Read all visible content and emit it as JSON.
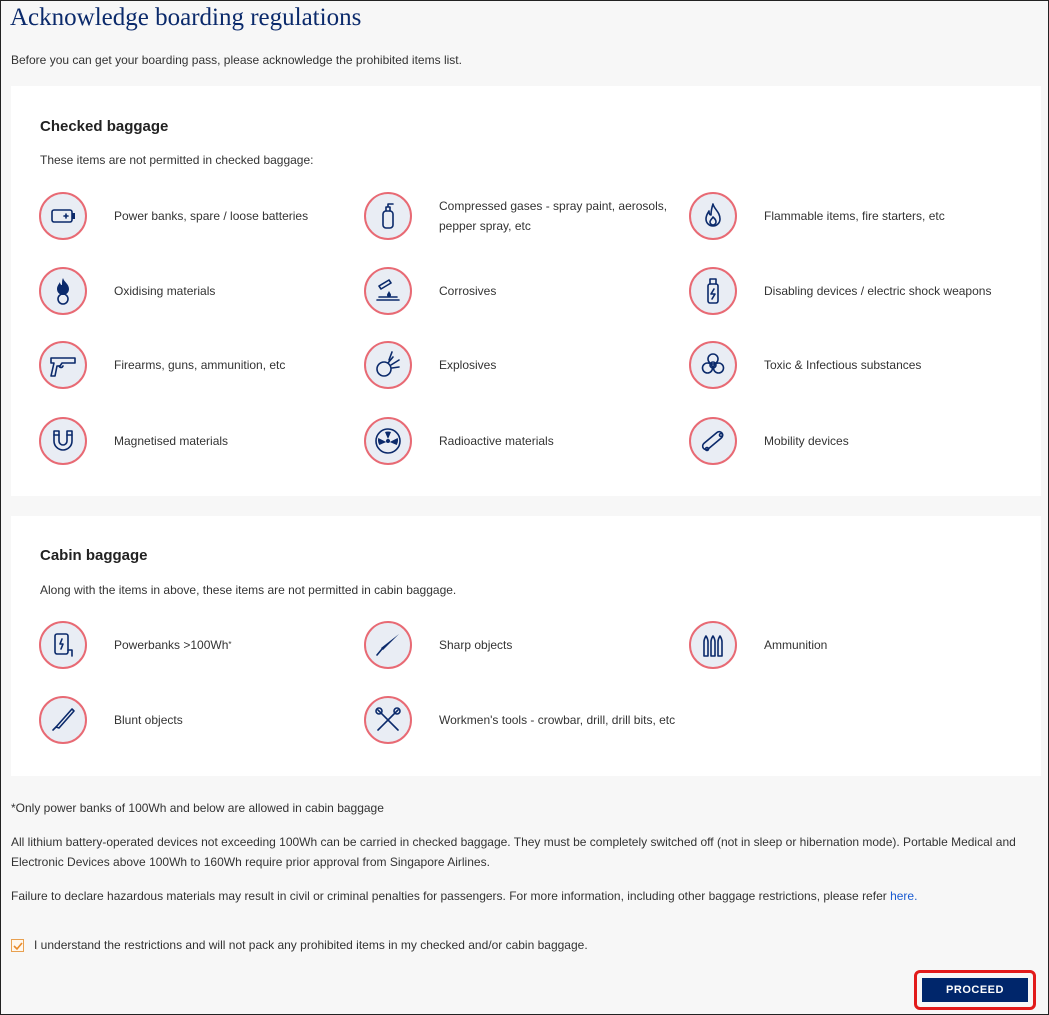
{
  "page": {
    "title": "Acknowledge boarding regulations",
    "intro": "Before you can get your boarding pass, please acknowledge the prohibited items list."
  },
  "checked": {
    "title": "Checked baggage",
    "subtitle": "These items are not permitted in checked baggage:",
    "items": [
      {
        "label": "Power banks, spare / loose batteries",
        "icon": "battery-icon"
      },
      {
        "label": "Compressed gases - spray paint, aerosols, pepper spray, etc",
        "icon": "gas-cylinder-icon"
      },
      {
        "label": "Flammable items, fire starters, etc",
        "icon": "flame-icon"
      },
      {
        "label": "Oxidising materials",
        "icon": "oxidiser-icon"
      },
      {
        "label": "Corrosives",
        "icon": "corrosive-icon"
      },
      {
        "label": "Disabling devices / electric shock weapons",
        "icon": "taser-icon"
      },
      {
        "label": "Firearms, guns, ammunition, etc",
        "icon": "gun-icon"
      },
      {
        "label": "Explosives",
        "icon": "explosive-icon"
      },
      {
        "label": "Toxic & Infectious substances",
        "icon": "biohazard-icon"
      },
      {
        "label": "Magnetised materials",
        "icon": "magnet-icon"
      },
      {
        "label": "Radioactive materials",
        "icon": "radioactive-icon"
      },
      {
        "label": "Mobility devices",
        "icon": "skateboard-icon"
      }
    ]
  },
  "cabin": {
    "title": "Cabin baggage",
    "subtitle": "Along with the items in above, these items are not permitted in cabin baggage.",
    "items": [
      {
        "label": "Powerbanks >100Wh",
        "sup": "*",
        "icon": "powerbank-icon"
      },
      {
        "label": "Sharp objects",
        "icon": "knife-icon"
      },
      {
        "label": "Ammunition",
        "icon": "ammunition-icon"
      },
      {
        "label": "Blunt objects",
        "icon": "bat-icon"
      },
      {
        "label": "Workmen's tools - crowbar, drill, drill bits, etc",
        "icon": "tools-icon"
      }
    ]
  },
  "notes": {
    "note1": "*Only power banks of 100Wh and below are allowed in cabin baggage",
    "note2": "All lithium battery-operated devices not exceeding 100Wh can be carried in checked baggage. They must be completely switched off (not in sleep or hibernation mode). Portable Medical and Electronic Devices above 100Wh to 160Wh require prior approval from Singapore Airlines.",
    "note3": "Failure to declare hazardous materials may result in civil or criminal penalties for passengers. For more information, including other baggage restrictions, please refer ",
    "link": "here."
  },
  "ack": {
    "checked": true,
    "label": "I understand the restrictions and will not pack any prohibited items in my checked and/or cabin baggage."
  },
  "proceed": "PROCEED",
  "colors": {
    "navy": "#00266b",
    "icon_border": "#e86a74",
    "highlight": "#e21b1b",
    "link": "#1a5bd1"
  }
}
